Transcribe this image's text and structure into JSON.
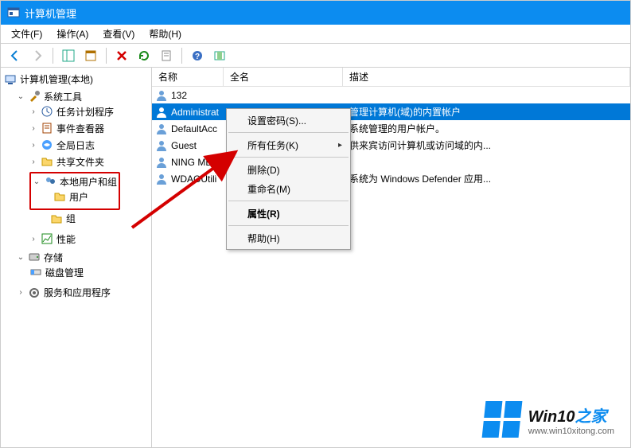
{
  "title": "计算机管理",
  "menu": {
    "file": "文件(F)",
    "action": "操作(A)",
    "view": "查看(V)",
    "help": "帮助(H)"
  },
  "tree": {
    "root": "计算机管理(本地)",
    "systools": "系统工具",
    "schedtasks": "任务计划程序",
    "eventviewer": "事件查看器",
    "globallogs": "全局日志",
    "sharedfolders": "共享文件夹",
    "localusers": "本地用户和组",
    "users": "用户",
    "groups": "组",
    "perf": "性能",
    "storage": "存储",
    "diskmgmt": "磁盘管理",
    "services": "服务和应用程序"
  },
  "columns": {
    "name": "名称",
    "fullname": "全名",
    "desc": "描述"
  },
  "rows": [
    {
      "name": "132",
      "full": "",
      "desc": ""
    },
    {
      "name": "Administrat",
      "full": "",
      "desc": "管理计算机(域)的内置帐户"
    },
    {
      "name": "DefaultAcc",
      "full": "",
      "desc": "系统管理的用户帐户。"
    },
    {
      "name": "Guest",
      "full": "",
      "desc": "供来宾访问计算机或访问域的内..."
    },
    {
      "name": "NING ME",
      "full": "",
      "desc": ""
    },
    {
      "name": "WDAGUtili",
      "full": "",
      "desc": "系统为 Windows Defender 应用..."
    }
  ],
  "ctx": {
    "setpwd": "设置密码(S)...",
    "alltasks": "所有任务(K)",
    "del": "删除(D)",
    "rename": "重命名(M)",
    "props": "属性(R)",
    "help": "帮助(H)"
  },
  "watermark": {
    "brand_a": "Win10",
    "brand_b": "之家",
    "url": "www.win10xitong.com"
  }
}
